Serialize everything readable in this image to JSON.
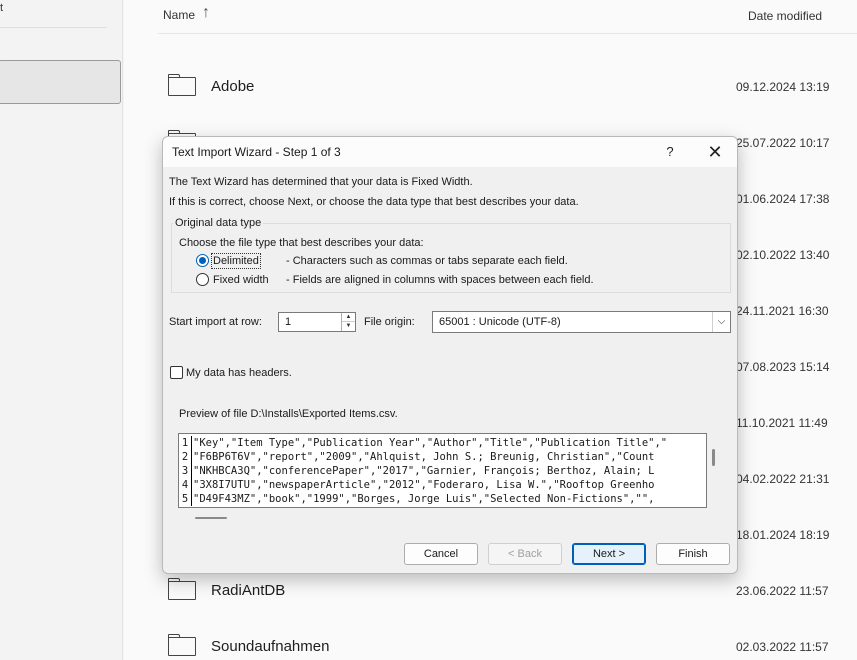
{
  "nav": {
    "label_fragment": "t"
  },
  "file_list": {
    "header_name": "Name",
    "sort_arrow": "↑",
    "header_date": "Date modified",
    "rows": [
      {
        "name": "Adobe",
        "date": "09.12.2024 13:19"
      },
      {
        "name": "",
        "date": "25.07.2022 10:17"
      },
      {
        "name": "",
        "date": "01.06.2024 17:38"
      },
      {
        "name": "",
        "date": "02.10.2022 13:40"
      },
      {
        "name": "",
        "date": "24.11.2021 16:30"
      },
      {
        "name": "",
        "date": "07.08.2023 15:14"
      },
      {
        "name": "",
        "date": "11.10.2021 11:49"
      },
      {
        "name": "",
        "date": "04.02.2022 21:31"
      },
      {
        "name": "",
        "date": "18.01.2024 18:19"
      },
      {
        "name": "RadiAntDB",
        "date": "23.06.2022 11:57"
      },
      {
        "name": "Soundaufnahmen",
        "date": "02.03.2022 11:57"
      }
    ]
  },
  "dialog": {
    "title": "Text Import Wizard - Step 1 of 3",
    "help": "?",
    "close": "✕",
    "message1": "The Text Wizard has determined that your data is Fixed Width.",
    "message2": "If this is correct, choose Next, or choose the data type that best describes your data.",
    "group_title": "Original data type",
    "choose_label": "Choose the file type that best describes your data:",
    "options": [
      {
        "label": "Delimited",
        "desc": "- Characters such as commas or tabs separate each field.",
        "selected": true
      },
      {
        "label": "Fixed width",
        "desc": "- Fields are aligned in columns with spaces between each field.",
        "selected": false
      }
    ],
    "start_row_label": "Start import at row:",
    "start_row_value": "1",
    "file_origin_label": "File origin:",
    "file_origin_value": "65001 : Unicode (UTF-8)",
    "headers_label": "My data has headers.",
    "headers_checked": false,
    "preview_label": "Preview of file D:\\Installs\\Exported Items.csv.",
    "preview_lines": [
      {
        "num": "1",
        "text": "\"Key\",\"Item Type\",\"Publication Year\",\"Author\",\"Title\",\"Publication Title\",\""
      },
      {
        "num": "2",
        "text": "\"F6BP6T6V\",\"report\",\"2009\",\"Ahlquist, John S.; Breunig, Christian\",\"Count"
      },
      {
        "num": "3",
        "text": "\"NKHBCA3Q\",\"conferencePaper\",\"2017\",\"Garnier, François; Berthoz, Alain; L"
      },
      {
        "num": "4",
        "text": "\"3X8I7UTU\",\"newspaperArticle\",\"2012\",\"Foderaro, Lisa W.\",\"Rooftop Greenho"
      },
      {
        "num": "5",
        "text": "\"D49F43MZ\",\"book\",\"1999\",\"Borges, Jorge Luis\",\"Selected Non-Fictions\",\"\","
      }
    ],
    "buttons": {
      "cancel": "Cancel",
      "back": "< Back",
      "next": "Next >",
      "finish": "Finish"
    }
  }
}
